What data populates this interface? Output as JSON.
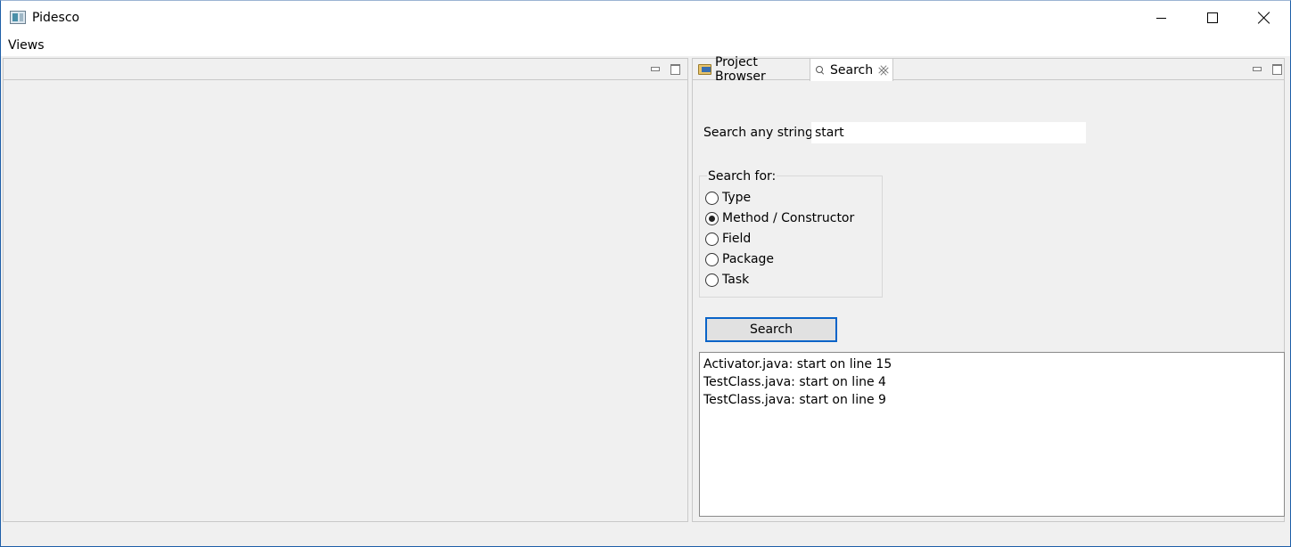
{
  "window": {
    "title": "Pidesco"
  },
  "menubar": {
    "items": [
      {
        "label": "Views"
      }
    ]
  },
  "right_pane": {
    "tabs": [
      {
        "label": "Project Browser",
        "icon": "folder-icon"
      },
      {
        "label": "Search",
        "icon": "magnifier-icon",
        "active": true
      }
    ],
    "search": {
      "label": "Search any string:",
      "value": "start",
      "group_title": "Search for:",
      "options": [
        {
          "label": "Type",
          "checked": false
        },
        {
          "label": "Method / Constructor",
          "checked": true
        },
        {
          "label": "Field",
          "checked": false
        },
        {
          "label": "Package",
          "checked": false
        },
        {
          "label": "Task",
          "checked": false
        }
      ],
      "button_label": "Search",
      "results": [
        "Activator.java: start on line 15",
        "TestClass.java: start on line 4",
        "TestClass.java: start on line 9"
      ]
    }
  },
  "colors": {
    "accent": "#0a64c8",
    "background": "#f0f0f0"
  }
}
